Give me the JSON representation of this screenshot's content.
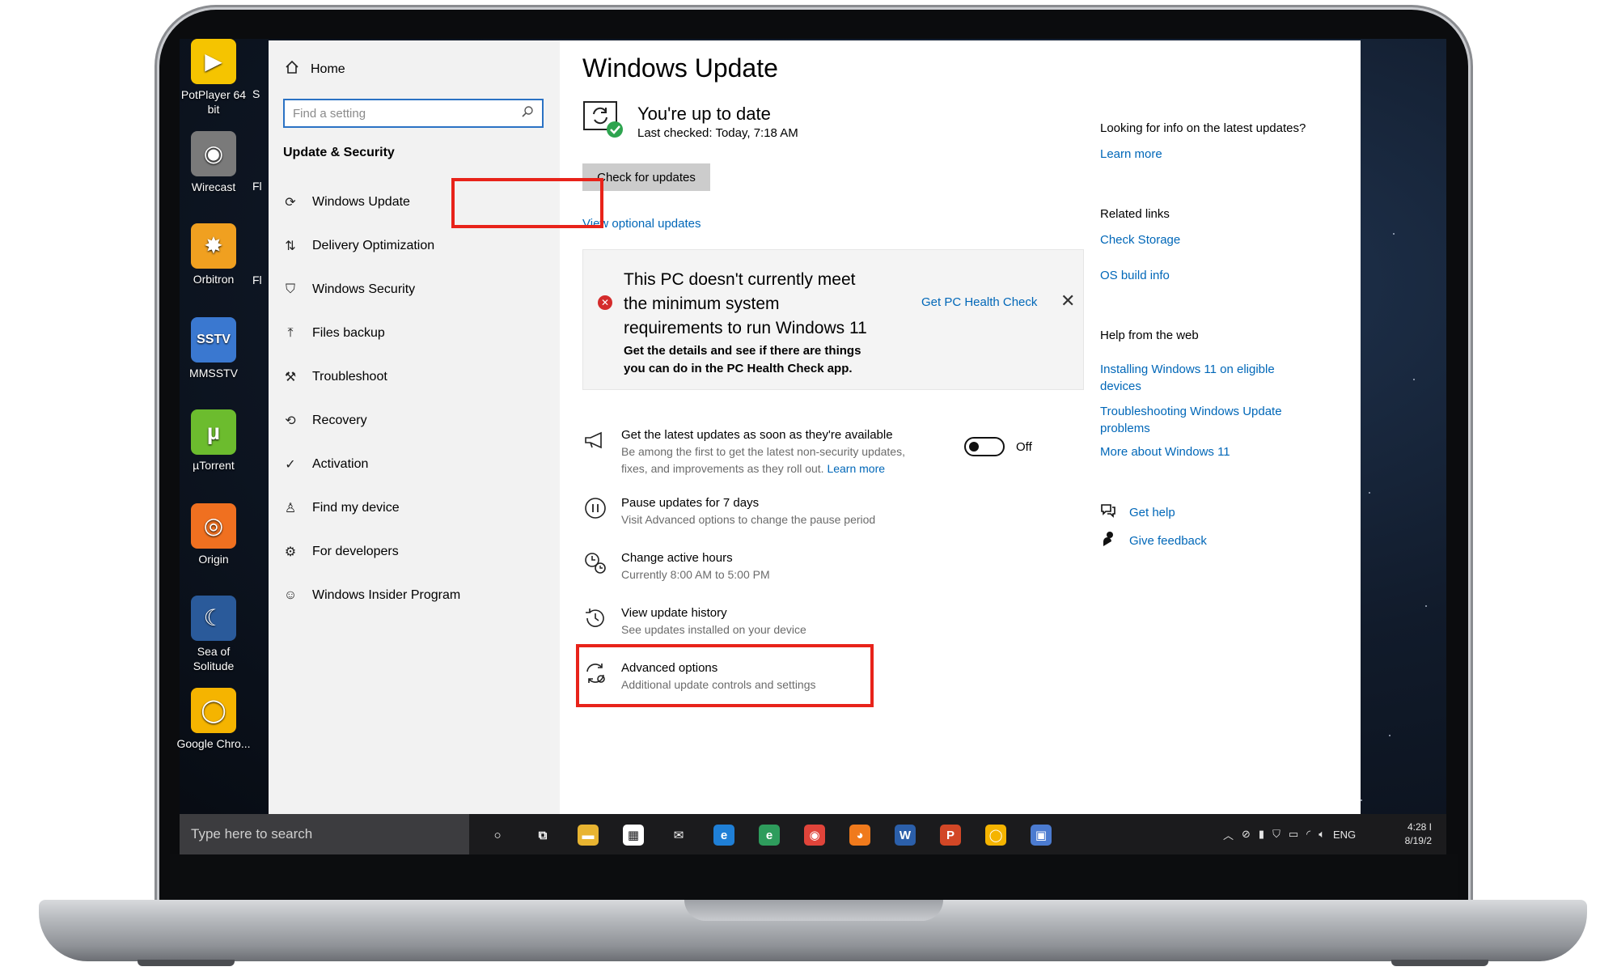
{
  "desktop": {
    "icons": [
      {
        "label": "PotPlayer 64 bit",
        "glyph": "▶",
        "color": "#f5c400"
      },
      {
        "label": "Wirecast",
        "glyph": "◉",
        "color": "#7a7a7a"
      },
      {
        "label": "Orbitron",
        "glyph": "✸",
        "color": "#f0a020"
      },
      {
        "label": "MMSSTV",
        "glyph": "SSTV",
        "color": "#3a78d0"
      },
      {
        "label": "µTorrent",
        "glyph": "µ",
        "color": "#6cbc2e"
      },
      {
        "label": "Origin",
        "glyph": "◎",
        "color": "#f07020"
      },
      {
        "label": "Sea of Solitude",
        "glyph": "☾",
        "color": "#2a5a9a"
      },
      {
        "label": "Google Chro...",
        "glyph": "◯",
        "color": "#f5b400"
      }
    ],
    "partial_labels": [
      "S",
      "Fl",
      "Fl"
    ]
  },
  "sidebar": {
    "home_label": "Home",
    "search_placeholder": "Find a setting",
    "section_title": "Update & Security",
    "items": [
      {
        "label": "Windows Update",
        "icon": "refresh-icon",
        "glyph": "⟳"
      },
      {
        "label": "Delivery Optimization",
        "icon": "delivery-icon",
        "glyph": "⇅"
      },
      {
        "label": "Windows Security",
        "icon": "shield-icon",
        "glyph": "⛉"
      },
      {
        "label": "Files backup",
        "icon": "upload-icon",
        "glyph": "⤒"
      },
      {
        "label": "Troubleshoot",
        "icon": "wrench-icon",
        "glyph": "⚒"
      },
      {
        "label": "Recovery",
        "icon": "recovery-icon",
        "glyph": "⟲"
      },
      {
        "label": "Activation",
        "icon": "check-circle-icon",
        "glyph": "✓"
      },
      {
        "label": "Find my device",
        "icon": "person-icon",
        "glyph": "♙"
      },
      {
        "label": "For developers",
        "icon": "developer-icon",
        "glyph": "⚙"
      },
      {
        "label": "Windows Insider Program",
        "icon": "insider-icon",
        "glyph": "☺"
      }
    ]
  },
  "main": {
    "title": "Windows Update",
    "status_title": "You're up to date",
    "status_sub": "Last checked: Today, 7:18 AM",
    "check_button": "Check for updates",
    "optional_link": "View optional updates",
    "notice": {
      "title": "This PC doesn't currently meet the minimum system requirements to run Windows 11",
      "body": "Get the details and see if there are things you can do in the PC Health Check app.",
      "link": "Get PC Health Check",
      "close": "✕"
    },
    "options": [
      {
        "title": "Get the latest updates as soon as they're available",
        "desc": "Be among the first to get the latest non-security updates, fixes, and improvements as they roll out.",
        "desc_link": "Learn more",
        "icon": "megaphone-icon"
      },
      {
        "title": "Pause updates for 7 days",
        "desc": "Visit Advanced options to change the pause period",
        "icon": "pause-icon"
      },
      {
        "title": "Change active hours",
        "desc": "Currently 8:00 AM to 5:00 PM",
        "icon": "clock-icon"
      },
      {
        "title": "View update history",
        "desc": "See updates installed on your device",
        "icon": "history-icon"
      },
      {
        "title": "Advanced options",
        "desc": "Additional update controls and settings",
        "icon": "advanced-gear-icon"
      }
    ],
    "toggle_label": "Off"
  },
  "right": {
    "info_title": "Looking for info on the latest updates?",
    "info_link": "Learn more",
    "related_title": "Related links",
    "related_links": [
      "Check Storage",
      "OS build info"
    ],
    "web_title": "Help from the web",
    "web_links": [
      "Installing Windows 11 on eligible devices",
      "Troubleshooting Windows Update problems",
      "More about Windows 11"
    ],
    "get_help": "Get help",
    "give_feedback": "Give feedback"
  },
  "taskbar": {
    "search_placeholder": "Type here to search",
    "apps": [
      {
        "name": "cortana-icon",
        "glyph": "○",
        "color": "transparent"
      },
      {
        "name": "task-view-icon",
        "glyph": "⧉",
        "color": "transparent"
      },
      {
        "name": "file-explorer-icon",
        "glyph": "▬",
        "color": "#e8b431"
      },
      {
        "name": "store-icon",
        "glyph": "▦",
        "color": "#ffffff"
      },
      {
        "name": "mail-icon",
        "glyph": "✉",
        "color": "transparent"
      },
      {
        "name": "edge-icon",
        "glyph": "e",
        "color": "#1f7fd6"
      },
      {
        "name": "edge-dev-icon",
        "glyph": "e",
        "color": "#2e9c5c"
      },
      {
        "name": "chrome-icon",
        "glyph": "◉",
        "color": "#e0443a"
      },
      {
        "name": "firefox-icon",
        "glyph": "◕",
        "color": "#f07a1c"
      },
      {
        "name": "word-icon",
        "glyph": "W",
        "color": "#2b5faa"
      },
      {
        "name": "powerpoint-icon",
        "glyph": "P",
        "color": "#d24726"
      },
      {
        "name": "chrome-canary-icon",
        "glyph": "◯",
        "color": "#f5b400"
      },
      {
        "name": "remote-desktop-icon",
        "glyph": "▣",
        "color": "#4b7bd0"
      }
    ],
    "tray_lang": "ENG",
    "time": "4:28 I",
    "date": "8/19/2"
  },
  "colors": {
    "accent": "#0067b8",
    "highlight": "#e8231a",
    "error": "#d42b2b",
    "success": "#2ea44f"
  }
}
